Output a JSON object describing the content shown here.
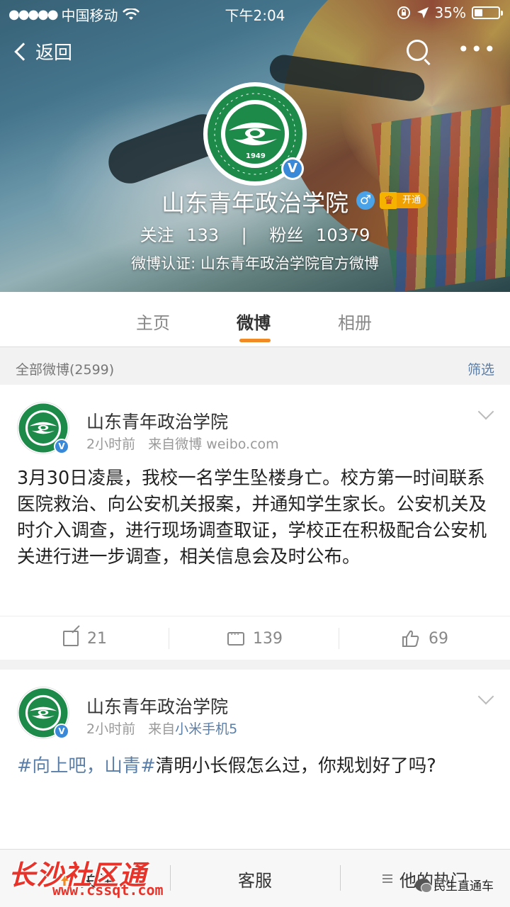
{
  "status_bar": {
    "signal_dots": "●●●●●",
    "carrier": "中国移动",
    "wifi_icon": "wifi-icon",
    "time": "下午2:04",
    "battery_percent": "35%",
    "battery_level": 0.35
  },
  "nav": {
    "back_label": "返回"
  },
  "profile": {
    "avatar_year": "1949",
    "name": "山东青年政治学院",
    "gender_symbol": "♂",
    "vip_label": "开通",
    "following_label": "关注",
    "following_count": "133",
    "separator": "|",
    "followers_label": "粉丝",
    "followers_count": "10379",
    "verification": "微博认证: 山东青年政治学院官方微博"
  },
  "tabs": [
    {
      "label": "主页",
      "active": false
    },
    {
      "label": "微博",
      "active": true
    },
    {
      "label": "相册",
      "active": false
    }
  ],
  "filter": {
    "all_label": "全部微博(2599)",
    "filter_label": "筛选"
  },
  "posts": [
    {
      "author": "山东青年政治学院",
      "time": "2小时前",
      "source_prefix": "来自",
      "source": "微博 weibo.com",
      "source_link": false,
      "content": "3月30日凌晨，我校一名学生坠楼身亡。校方第一时间联系医院救治、向公安机关报案，并通知学生家长。公安机关及时介入调查，进行现场调查取证，学校正在积极配合公安机关进行进一步调查，相关信息会及时公布。",
      "reposts": "21",
      "comments": "139",
      "likes": "69"
    },
    {
      "author": "山东青年政治学院",
      "time": "2小时前",
      "source_prefix": "来自",
      "source": "小米手机5",
      "source_link": true,
      "topic": "#向上吧，山青#",
      "content": "清明小长假怎么过，你规划好了吗?"
    }
  ],
  "bottom_bar": {
    "follow_plus": "+",
    "follow_label": "关注",
    "service_label": "客服",
    "hot_label": "他的热门"
  },
  "watermarks": {
    "site_name": "长沙社区通",
    "site_url": "www.cssqt.com",
    "wechat_account": "民生直通车"
  }
}
